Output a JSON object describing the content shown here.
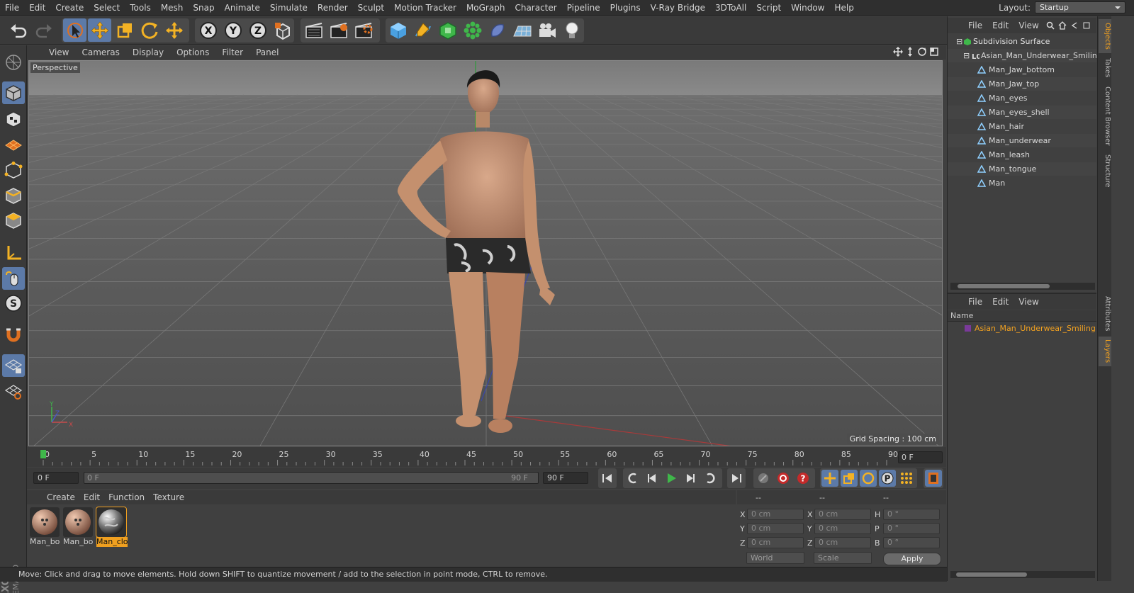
{
  "menubar": {
    "items": [
      "File",
      "Edit",
      "Create",
      "Select",
      "Tools",
      "Mesh",
      "Snap",
      "Animate",
      "Simulate",
      "Render",
      "Sculpt",
      "Motion Tracker",
      "MoGraph",
      "Character",
      "Pipeline",
      "Plugins",
      "V-Ray Bridge",
      "3DToAll",
      "Script",
      "Window",
      "Help"
    ],
    "layout_label": "Layout:",
    "layout_value": "Startup"
  },
  "toolbar": {
    "x_label": "X",
    "y_label": "Y",
    "z_label": "Z",
    "icons": [
      "undo-icon",
      "redo-icon",
      "select-arrow-icon",
      "move-icon",
      "scale-icon",
      "rotate-icon",
      "live-select-icon",
      "x-axis-icon",
      "y-axis-icon",
      "z-axis-icon",
      "coordinate-system-icon",
      "render-view-icon",
      "render-picture-viewer-icon",
      "render-settings-icon",
      "cube-icon",
      "pen-spline-icon",
      "nurbs-icon",
      "mograph-cloner-icon",
      "deformer-icon",
      "floor-icon",
      "camera-icon",
      "light-icon"
    ]
  },
  "viewport": {
    "menu": [
      "View",
      "Cameras",
      "Display",
      "Options",
      "Filter",
      "Panel"
    ],
    "camera_label": "Perspective",
    "grid_spacing": "Grid Spacing : 100 cm",
    "axis": {
      "x": "X",
      "y": "Y",
      "z": "Z"
    }
  },
  "timeline": {
    "ticks": [
      "0",
      "5",
      "10",
      "15",
      "20",
      "25",
      "30",
      "35",
      "40",
      "45",
      "50",
      "55",
      "60",
      "65",
      "70",
      "75",
      "80",
      "85",
      "90"
    ],
    "current_frame": "0 F",
    "start_frame": "0 F",
    "range_start": "0 F",
    "range_end": "90 F",
    "end_frame": "90 F"
  },
  "materials": {
    "menu": [
      "Create",
      "Edit",
      "Function",
      "Texture"
    ],
    "items": [
      {
        "label": "Man_bo",
        "selected": false
      },
      {
        "label": "Man_bo",
        "selected": false
      },
      {
        "label": "Man_clo",
        "selected": true
      }
    ]
  },
  "coordinates": {
    "headers": [
      "--",
      "--",
      "--"
    ],
    "rows": [
      {
        "a": "X",
        "av": "0 cm",
        "b": "X",
        "bv": "0 cm",
        "c": "H",
        "cv": "0 °"
      },
      {
        "a": "Y",
        "av": "0 cm",
        "b": "Y",
        "bv": "0 cm",
        "c": "P",
        "cv": "0 °"
      },
      {
        "a": "Z",
        "av": "0 cm",
        "b": "Z",
        "bv": "0 cm",
        "c": "B",
        "cv": "0 °"
      }
    ],
    "mode1": "World",
    "mode2": "Scale",
    "apply": "Apply"
  },
  "status": "Move: Click and drag to move elements. Hold down SHIFT to quantize movement / add to the selection in point mode, CTRL to remove.",
  "objects": {
    "menu": [
      "File",
      "Edit",
      "View"
    ],
    "tree": [
      {
        "label": "Subdivision Surface",
        "level": 0,
        "type": "subdiv"
      },
      {
        "label": "Asian_Man_Underwear_Smiling",
        "level": 1,
        "type": "null"
      },
      {
        "label": "Man_Jaw_bottom",
        "level": 2,
        "type": "poly"
      },
      {
        "label": "Man_Jaw_top",
        "level": 2,
        "type": "poly"
      },
      {
        "label": "Man_eyes",
        "level": 2,
        "type": "poly"
      },
      {
        "label": "Man_eyes_shell",
        "level": 2,
        "type": "poly"
      },
      {
        "label": "Man_hair",
        "level": 2,
        "type": "poly"
      },
      {
        "label": "Man_underwear",
        "level": 2,
        "type": "poly"
      },
      {
        "label": "Man_leash",
        "level": 2,
        "type": "poly"
      },
      {
        "label": "Man_tongue",
        "level": 2,
        "type": "poly"
      },
      {
        "label": "Man",
        "level": 2,
        "type": "poly"
      }
    ]
  },
  "layers": {
    "menu": [
      "File",
      "Edit",
      "View"
    ],
    "column": "Name",
    "items": [
      "Asian_Man_Underwear_Smiling"
    ]
  },
  "side_tabs": [
    "Objects",
    "Takes",
    "Content Browser",
    "Structure",
    "Attributes",
    "Layers"
  ],
  "colors": {
    "accent": "#f0a020",
    "selection": "#5c7aa8",
    "green": "#3fb74a"
  }
}
